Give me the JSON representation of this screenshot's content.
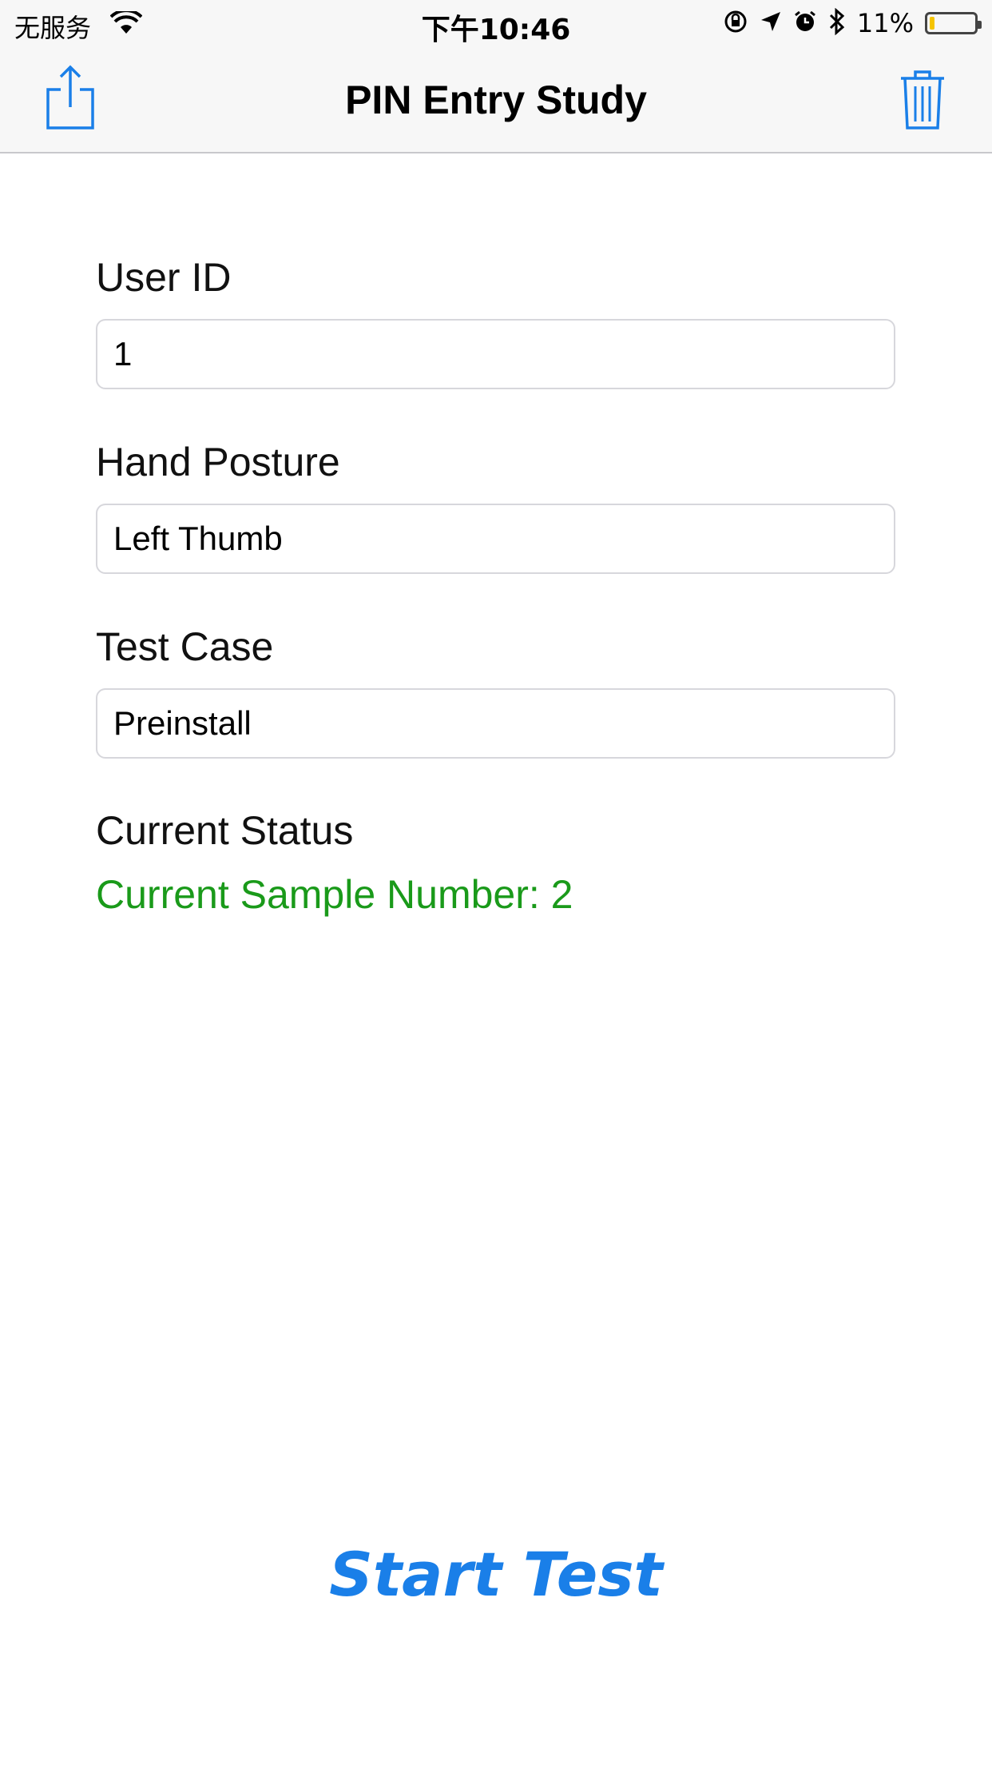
{
  "status_bar": {
    "carrier": "无服务",
    "time": "下午10:46",
    "battery_percent": "11%",
    "battery_level": 0.11,
    "battery_color": "#f5c400",
    "icons": [
      "wifi-icon",
      "orientation-lock-icon",
      "location-arrow-icon",
      "alarm-icon",
      "bluetooth-icon",
      "battery-icon"
    ]
  },
  "nav": {
    "title": "PIN Entry Study",
    "left_icon": "share-icon",
    "right_icon": "trash-icon",
    "accent_color": "#1a7fe8"
  },
  "form": {
    "user_id_label": "User ID",
    "user_id_value": "1",
    "hand_posture_label": "Hand Posture",
    "hand_posture_value": "Left Thumb",
    "test_case_label": "Test Case",
    "test_case_value": "Preinstall",
    "status_label": "Current Status",
    "status_text": "Current Sample Number: 2",
    "status_color": "#1a9a1a"
  },
  "actions": {
    "start_label": "Start Test"
  }
}
